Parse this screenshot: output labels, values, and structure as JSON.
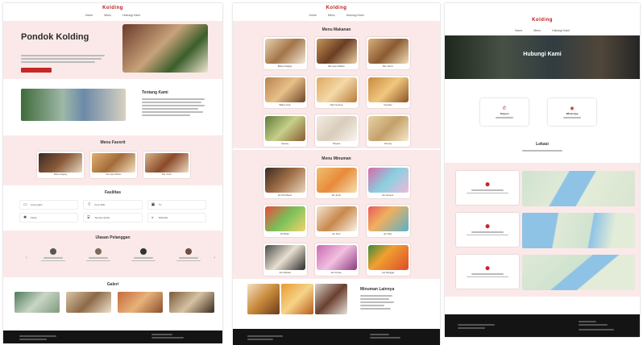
{
  "colors": {
    "accent": "#c62828",
    "pink_bg": "#fbe9e9",
    "footer": "#141414"
  },
  "site": {
    "logo": "Kolding",
    "nav": [
      "Home",
      "Menu",
      "Hubungi Kami"
    ]
  },
  "hero": {
    "title": "Pondok Kolding"
  },
  "about": {
    "title": "Tentang Kami"
  },
  "favorites": {
    "title": "Menu Favorit",
    "items": [
      "Bakso Daging",
      "Mie Ayam Bakso",
      "Mie Yamin"
    ]
  },
  "facilities": {
    "title": "Fasilitas",
    "items": [
      {
        "icon": "parking-icon",
        "glyph": "▭",
        "label": "Area parkir"
      },
      {
        "icon": "wifi-icon",
        "glyph": "⌔",
        "label": "Free WiFi"
      },
      {
        "icon": "tv-icon",
        "glyph": "▣",
        "label": "TV"
      },
      {
        "icon": "fan-icon",
        "glyph": "✺",
        "label": "Kipas"
      },
      {
        "icon": "chair-icon",
        "glyph": "⌸",
        "label": "Tempat duduk"
      },
      {
        "icon": "sink-icon",
        "glyph": "◒",
        "label": "Wastafel"
      }
    ]
  },
  "reviews": {
    "title": "Ulasan Pelanggan",
    "prev": "‹",
    "next": "›"
  },
  "gallery": {
    "title": "Galeri"
  },
  "makanan": {
    "title": "Menu Makanan",
    "items": [
      "Bakso Daging",
      "Mie Ayam Bakso",
      "Mie Yamin",
      "Bakso Urat",
      "Nasi Goreng",
      "Kwetiau",
      "Capcay",
      "Pangsit",
      "Siomay"
    ]
  },
  "minuman": {
    "title": "Menu Minuman",
    "items": [
      "Es Teh Manis",
      "Es Jeruk",
      "Es Campur",
      "Es Buah",
      "Es Kopi",
      "Es Teler",
      "Jus Alpukat",
      "Es Cincau",
      "Jus Mangga"
    ]
  },
  "minuman_lain": {
    "title": "Minuman Lainnya"
  },
  "contact": {
    "title": "Hubungi Kami",
    "items": [
      {
        "icon": "phone-icon",
        "glyph": "✆",
        "label": "Telepon"
      },
      {
        "icon": "whatsapp-icon",
        "glyph": "◉",
        "label": "WhatsApp"
      }
    ]
  },
  "lokasi": {
    "title": "Lokasi",
    "items": [
      {
        "icon": "map-pin-icon",
        "glyph": "⬤"
      },
      {
        "icon": "map-pin-icon",
        "glyph": "⬤"
      },
      {
        "icon": "map-pin-icon",
        "glyph": "⬤"
      }
    ]
  }
}
